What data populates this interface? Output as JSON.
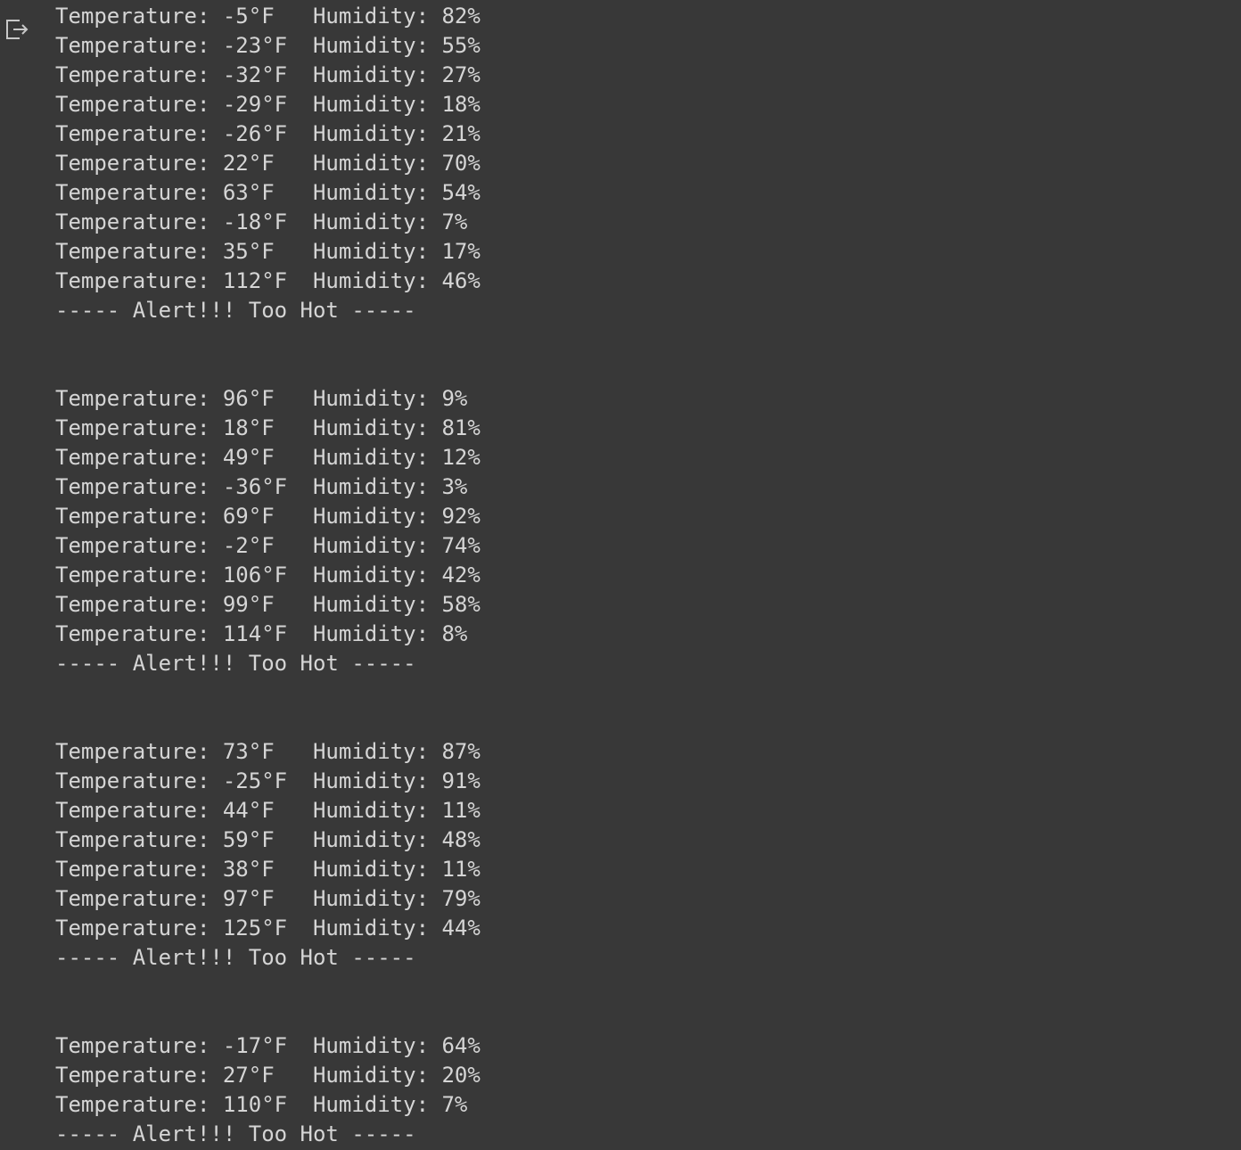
{
  "output": {
    "icon": "output-redirect-icon",
    "lines": [
      "Temperature: -5°F\tHumidity: 82%",
      "Temperature: -23°F\tHumidity: 55%",
      "Temperature: -32°F\tHumidity: 27%",
      "Temperature: -29°F\tHumidity: 18%",
      "Temperature: -26°F\tHumidity: 21%",
      "Temperature: 22°F\tHumidity: 70%",
      "Temperature: 63°F\tHumidity: 54%",
      "Temperature: -18°F\tHumidity: 7%",
      "Temperature: 35°F\tHumidity: 17%",
      "Temperature: 112°F\tHumidity: 46%",
      "----- Alert!!! Too Hot -----",
      "",
      "",
      "Temperature: 96°F\tHumidity: 9%",
      "Temperature: 18°F\tHumidity: 81%",
      "Temperature: 49°F\tHumidity: 12%",
      "Temperature: -36°F\tHumidity: 3%",
      "Temperature: 69°F\tHumidity: 92%",
      "Temperature: -2°F\tHumidity: 74%",
      "Temperature: 106°F\tHumidity: 42%",
      "Temperature: 99°F\tHumidity: 58%",
      "Temperature: 114°F\tHumidity: 8%",
      "----- Alert!!! Too Hot -----",
      "",
      "",
      "Temperature: 73°F\tHumidity: 87%",
      "Temperature: -25°F\tHumidity: 91%",
      "Temperature: 44°F\tHumidity: 11%",
      "Temperature: 59°F\tHumidity: 48%",
      "Temperature: 38°F\tHumidity: 11%",
      "Temperature: 97°F\tHumidity: 79%",
      "Temperature: 125°F\tHumidity: 44%",
      "----- Alert!!! Too Hot -----",
      "",
      "",
      "Temperature: -17°F\tHumidity: 64%",
      "Temperature: 27°F\tHumidity: 20%",
      "Temperature: 110°F\tHumidity: 7%",
      "----- Alert!!! Too Hot -----"
    ]
  }
}
